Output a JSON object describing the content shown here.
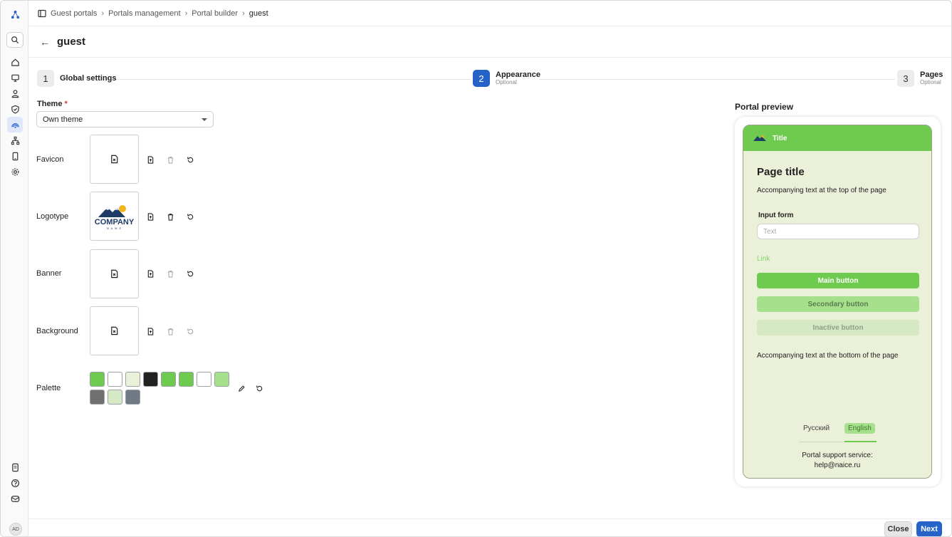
{
  "breadcrumb": [
    "Guest portals",
    "Portals management",
    "Portal builder",
    "guest"
  ],
  "page": {
    "back_icon": "arrow-left-icon",
    "title": "guest"
  },
  "stepper": {
    "steps": [
      {
        "num": "1",
        "label": "Global settings",
        "sub": ""
      },
      {
        "num": "2",
        "label": "Appearance",
        "sub": "Optional"
      },
      {
        "num": "3",
        "label": "Pages",
        "sub": "Optional"
      }
    ],
    "active": 2
  },
  "theme": {
    "label": "Theme",
    "required": "*",
    "value": "Own theme"
  },
  "assets": {
    "favicon": "Favicon",
    "logotype": "Logotype",
    "banner": "Banner",
    "background": "Background",
    "palette": "Palette"
  },
  "logo": {
    "line1": "COMPANY",
    "line2": "N A M E"
  },
  "palette_colors": [
    "#6ecb4f",
    "#ffffff",
    "#ebf0d9",
    "#222222",
    "#6ecb4f",
    "#6ecb4f",
    "#ffffff",
    "#a6e08c",
    "#707070",
    "#d5e9c4",
    "#6f7a85"
  ],
  "preview": {
    "section_title": "Portal preview",
    "header_title": "Title",
    "page_title": "Page title",
    "top_text": "Accompanying text at the top of the page",
    "form_label": "Input form",
    "input_placeholder": "Text",
    "link": "Link",
    "main_button": "Main button",
    "secondary_button": "Secondary button",
    "inactive_button": "Inactive button",
    "bottom_text": "Accompanying text at the bottom of the page",
    "lang_ru": "Русский",
    "lang_en": "English",
    "support_line1": "Portal support service:",
    "support_line2": "help@naice.ru",
    "header_color": "#6ecb4f",
    "bg_color": "#ebf0d9"
  },
  "footer": {
    "close": "Close",
    "next": "Next"
  },
  "user": {
    "initials": "AD"
  }
}
